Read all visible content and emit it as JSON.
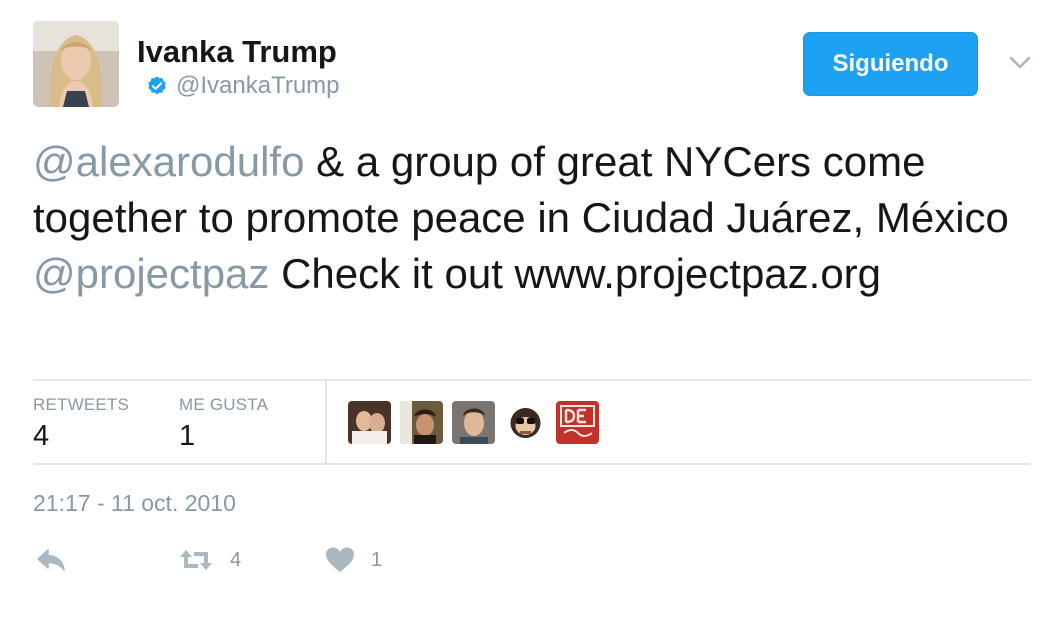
{
  "user": {
    "name": "Ivanka Trump",
    "handle": "@IvankaTrump",
    "verified": true
  },
  "follow_button": {
    "label": "Siguiendo"
  },
  "menu": {
    "icon": "chevron-down-icon"
  },
  "tweet": {
    "segments": [
      {
        "text": "@alexarodulfo",
        "type": "mention"
      },
      {
        "text": " & a group of great NYCers come together to promote peace in Ciudad Juárez, México ",
        "type": "text"
      },
      {
        "text": "@projectpaz",
        "type": "mention"
      },
      {
        "text": " Check it out ",
        "type": "text"
      },
      {
        "text": "www.projectpaz.org",
        "type": "link"
      }
    ]
  },
  "stats": {
    "retweets": {
      "label": "RETWEETS",
      "value": "4"
    },
    "likes": {
      "label": "ME GUSTA",
      "value": "1"
    }
  },
  "likers": [
    {
      "name": "liker-avatar-1"
    },
    {
      "name": "liker-avatar-2"
    },
    {
      "name": "liker-avatar-3"
    },
    {
      "name": "liker-avatar-4"
    },
    {
      "name": "liker-avatar-5"
    }
  ],
  "timestamp": "21:17 - 11 oct. 2010",
  "actions": {
    "reply": {
      "icon": "reply-icon"
    },
    "retweet": {
      "icon": "retweet-icon",
      "count": "4"
    },
    "like": {
      "icon": "heart-icon",
      "count": "1"
    }
  },
  "colors": {
    "accent": "#1da1f2",
    "muted": "#8899a6",
    "text": "#14171a",
    "divider": "#e1e8ed"
  }
}
